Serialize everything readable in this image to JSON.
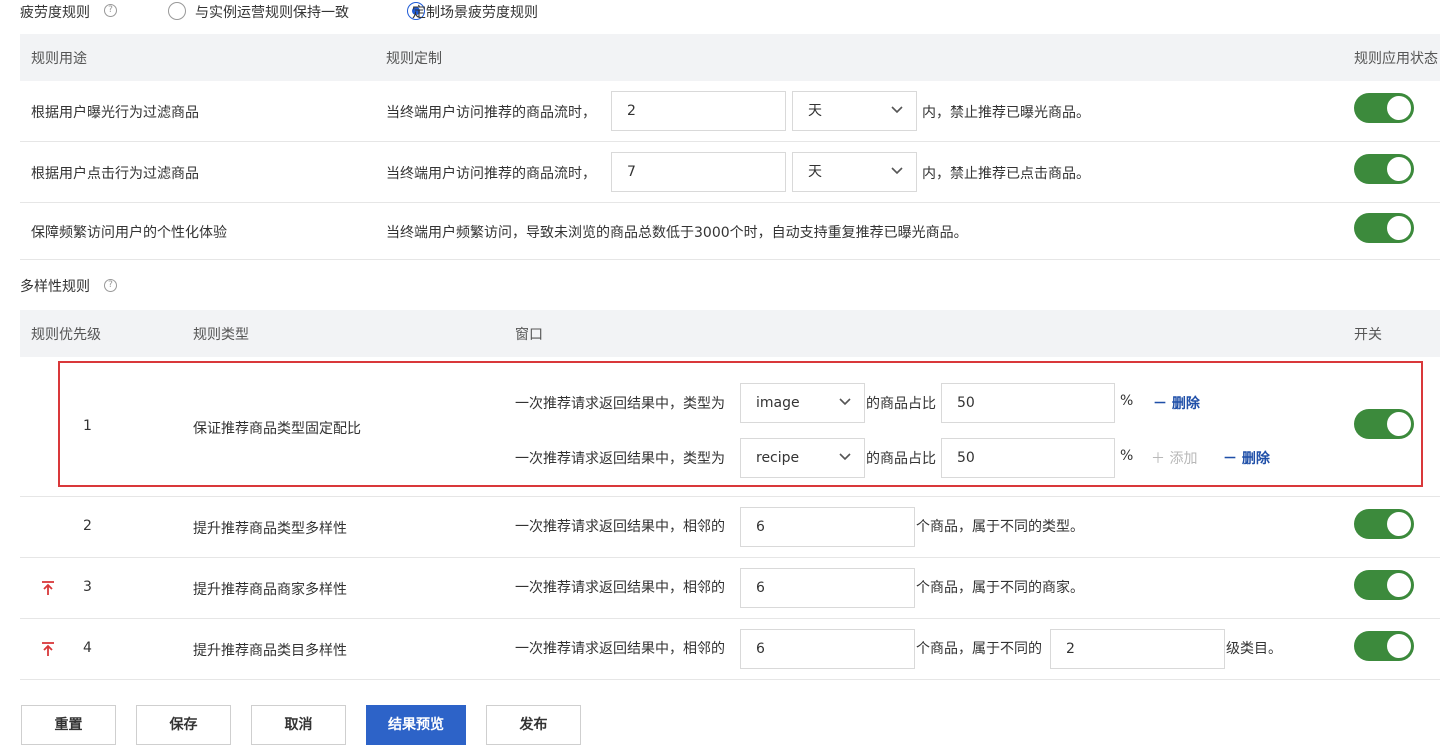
{
  "fatigue": {
    "title": "疲劳度规则",
    "option_consistent": "与实例运营规则保持一致",
    "option_custom": "定制场景疲劳度规则",
    "headers": {
      "purpose": "规则用途",
      "custom": "规则定制",
      "status": "规则应用状态"
    },
    "rows": [
      {
        "purpose": "根据用户曝光行为过滤商品",
        "prefix": "当终端用户访问推荐的商品流时，",
        "value": "2",
        "unit": "天",
        "suffix": "内，禁止推荐已曝光商品。"
      },
      {
        "purpose": "根据用户点击行为过滤商品",
        "prefix": "当终端用户访问推荐的商品流时，",
        "value": "7",
        "unit": "天",
        "suffix": "内，禁止推荐已点击商品。"
      },
      {
        "purpose": "保障频繁访问用户的个性化体验",
        "text": "当终端用户频繁访问，导致未浏览的商品总数低于3000个时，自动支持重复推荐已曝光商品。"
      }
    ]
  },
  "diversity": {
    "title": "多样性规则",
    "headers": {
      "priority": "规则优先级",
      "type": "规则类型",
      "window": "窗口",
      "switch": "开关"
    },
    "row1": {
      "priority": "1",
      "type": "保证推荐商品类型固定配比",
      "lines": [
        {
          "prefix": "一次推荐请求返回结果中，类型为",
          "select": "image",
          "mid": "的商品占比",
          "value": "50",
          "pct": "%",
          "delete": "删除"
        },
        {
          "prefix": "一次推荐请求返回结果中，类型为",
          "select": "recipe",
          "mid": "的商品占比",
          "value": "50",
          "pct": "%",
          "add": "添加",
          "delete": "删除"
        }
      ]
    },
    "row2": {
      "priority": "2",
      "type": "提升推荐商品类型多样性",
      "prefix": "一次推荐请求返回结果中，相邻的",
      "value": "6",
      "suffix": "个商品，属于不同的类型。"
    },
    "row3": {
      "priority": "3",
      "type": "提升推荐商品商家多样性",
      "prefix": "一次推荐请求返回结果中，相邻的",
      "value": "6",
      "suffix": "个商品，属于不同的商家。"
    },
    "row4": {
      "priority": "4",
      "type": "提升推荐商品类目多样性",
      "prefix": "一次推荐请求返回结果中，相邻的",
      "value": "6",
      "mid": "个商品，属于不同的",
      "value2": "2",
      "suffix": "级类目。"
    }
  },
  "buttons": {
    "reset": "重置",
    "save": "保存",
    "cancel": "取消",
    "preview": "结果预览",
    "publish": "发布"
  },
  "colors": {
    "accent": "#2d63c8",
    "toggle_on": "#3c8a3c",
    "highlight": "#d9383a",
    "priority_up": "#d9383a"
  }
}
